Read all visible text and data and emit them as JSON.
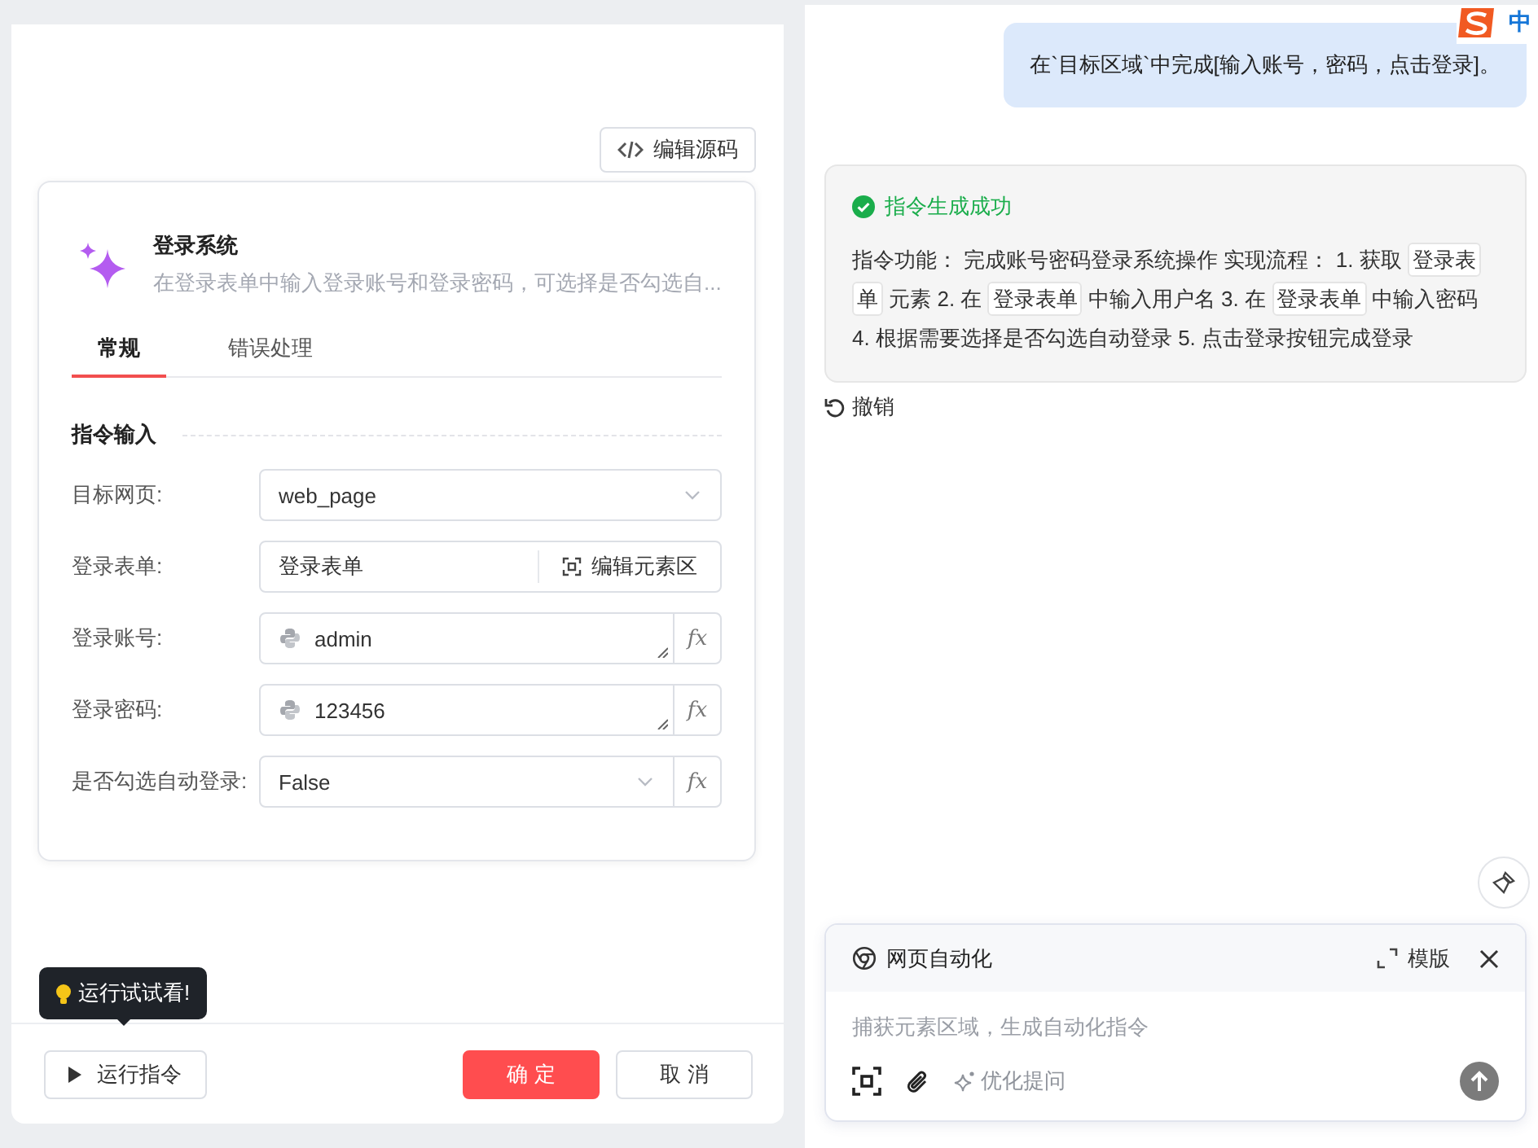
{
  "left_panel": {
    "source_button": "编辑源码",
    "card": {
      "title": "登录系统",
      "description": "在登录表单中输入登录账号和登录密码，可选择是否勾选自...",
      "tabs": [
        {
          "label": "常规",
          "selected": true
        },
        {
          "label": "错误处理",
          "selected": false
        }
      ],
      "section_title": "指令输入",
      "fields": [
        {
          "kind": "select",
          "label": "目标网页:",
          "value": "web_page"
        },
        {
          "kind": "element",
          "label": "登录表单:",
          "value": "登录表单",
          "action": "编辑元素区"
        },
        {
          "kind": "expression",
          "label": "登录账号:",
          "value": "admin",
          "formula_button": "fx"
        },
        {
          "kind": "expression",
          "label": "登录密码:",
          "value": "123456",
          "formula_button": "fx"
        },
        {
          "kind": "select_formula",
          "label": "是否勾选自动登录:",
          "value": "False",
          "formula_button": "fx"
        }
      ]
    },
    "tooltip": "运行试试看!",
    "run_button": "运行指令",
    "confirm_button": "确 定",
    "cancel_button": "取 消"
  },
  "chat": {
    "user_message": "在`目标区域`中完成[输入账号，密码，点击登录]。",
    "result": {
      "status": "指令生成成功",
      "segments": [
        {
          "kind": "text",
          "text": "指令功能： 完成账号密码登录系统操作 实现流程： 1. 获取 "
        },
        {
          "kind": "chip",
          "text": "登录表单"
        },
        {
          "kind": "text",
          "text": " 元素 2. 在 "
        },
        {
          "kind": "chip",
          "text": "登录表单"
        },
        {
          "kind": "text",
          "text": " 中输入用户名 3. 在 "
        },
        {
          "kind": "chip",
          "text": "登录表单"
        },
        {
          "kind": "text",
          "text": " 中输入密码 4. 根据需要选择是否勾选自动登录 5. 点击登录按钮完成登录"
        }
      ]
    },
    "undo": "撤销"
  },
  "composer": {
    "title": "网页自动化",
    "template_button": "模版",
    "placeholder": "捕获元素区域，生成自动化指令",
    "optimize_button": "优化提问"
  },
  "ime_indicator": "中"
}
